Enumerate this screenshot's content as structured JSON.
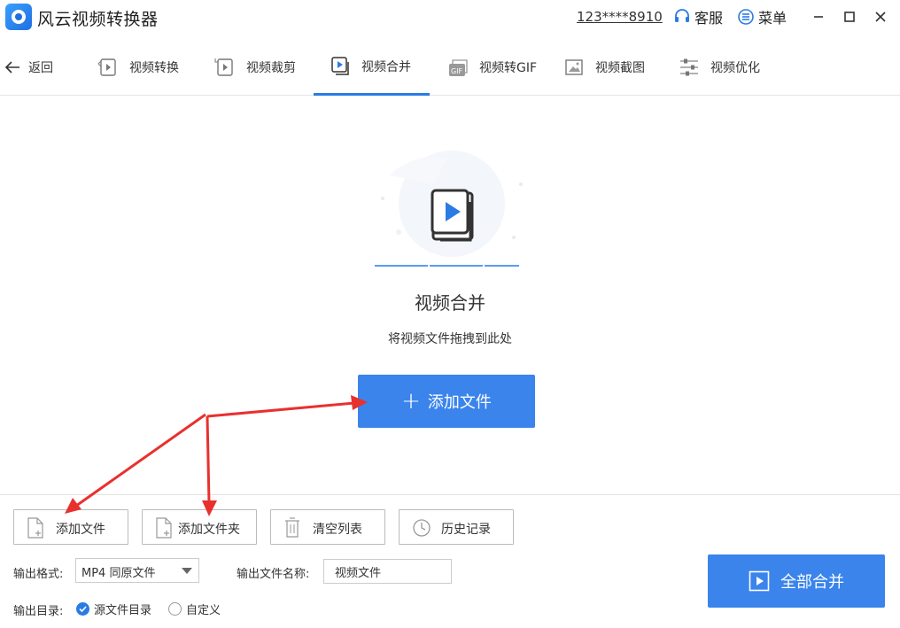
{
  "app": {
    "title": "风云视频转换器",
    "account": "123****8910",
    "support_label": "客服",
    "menu_label": "菜单"
  },
  "nav": {
    "back_label": "返回",
    "tabs": [
      {
        "label": "视频转换",
        "icon": "video-convert-icon"
      },
      {
        "label": "视频裁剪",
        "icon": "video-crop-icon"
      },
      {
        "label": "视频合并",
        "icon": "video-merge-icon",
        "active": true
      },
      {
        "label": "视频转GIF",
        "icon": "gif-icon"
      },
      {
        "label": "视频截图",
        "icon": "screenshot-icon"
      },
      {
        "label": "视频优化",
        "icon": "optimize-icon"
      }
    ]
  },
  "drop": {
    "title": "视频合并",
    "hint": "将视频文件拖拽到此处",
    "add_button": "添加文件"
  },
  "toolbar": {
    "add_file": "添加文件",
    "add_folder": "添加文件夹",
    "clear_list": "清空列表",
    "history": "历史记录"
  },
  "output": {
    "format_label": "输出格式:",
    "format_value": "MP4 同原文件",
    "name_label": "输出文件名称:",
    "name_value": "视频文件",
    "dir_label": "输出目录:",
    "dir_options": [
      {
        "label": "源文件目录",
        "checked": true
      },
      {
        "label": "自定义",
        "checked": false
      }
    ]
  },
  "merge_all_label": "全部合并",
  "colors": {
    "accent": "#3a84ec",
    "annotation_arrow": "#e8312f"
  }
}
